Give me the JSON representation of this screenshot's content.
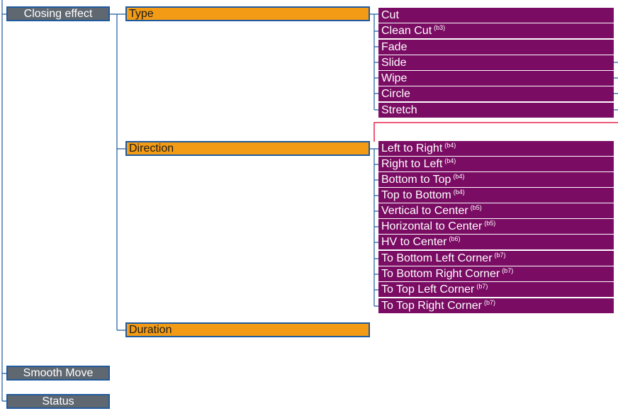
{
  "colors": {
    "category": "#5f6770",
    "property": "#f39b15",
    "option": "#7a0c63",
    "connector": "#1f5a9e",
    "highlight": "#e8234f"
  },
  "categories": [
    "Closing effect",
    "Smooth Move",
    "Status"
  ],
  "properties": [
    "Type",
    "Direction",
    "Duration"
  ],
  "type_options": [
    {
      "label": "Cut",
      "note": ""
    },
    {
      "label": "Clean Cut",
      "note": "(b3)"
    },
    {
      "label": "Fade",
      "note": ""
    },
    {
      "label": "Slide",
      "note": ""
    },
    {
      "label": "Wipe",
      "note": ""
    },
    {
      "label": "Circle",
      "note": ""
    },
    {
      "label": "Stretch",
      "note": ""
    }
  ],
  "direction_options": [
    {
      "label": "Left to Right",
      "note": "(b4)"
    },
    {
      "label": "Right to Left",
      "note": "(b4)"
    },
    {
      "label": "Bottom to Top",
      "note": "(b4)"
    },
    {
      "label": "Top to Bottom",
      "note": "(b4)"
    },
    {
      "label": "Vertical to Center",
      "note": "(b5)"
    },
    {
      "label": "Horizontal to Center",
      "note": "(b5)"
    },
    {
      "label": "HV to Center",
      "note": "(b6)"
    },
    {
      "label": "To Bottom Left Corner",
      "note": "(b7)"
    },
    {
      "label": "To Bottom Right Corner",
      "note": "(b7)"
    },
    {
      "label": "To Top Left Corner",
      "note": "(b7)"
    },
    {
      "label": "To Top Right Corner",
      "note": "(b7)"
    }
  ]
}
